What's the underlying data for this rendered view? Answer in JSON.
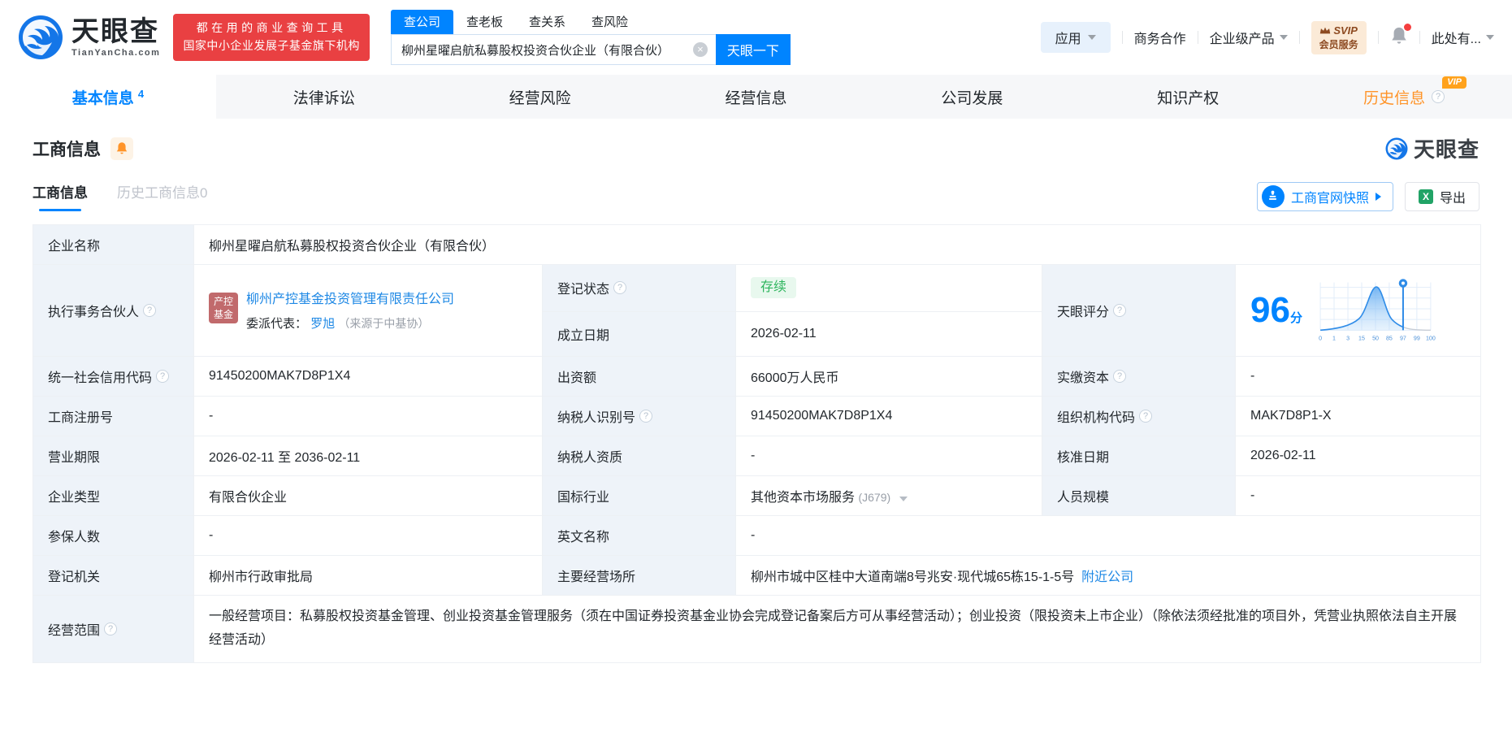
{
  "header": {
    "brand": "天眼查",
    "brand_domain": "TianYanCha.com",
    "slogan_line1": "都在用的商业查询工具",
    "slogan_line2": "国家中小企业发展子基金旗下机构",
    "search_tabs": [
      {
        "label": "查公司"
      },
      {
        "label": "查老板"
      },
      {
        "label": "查关系"
      },
      {
        "label": "查风险"
      }
    ],
    "search_value": "柳州星曜启航私募股权投资合伙企业（有限合伙）",
    "search_button": "天眼一下",
    "apps": "应用",
    "link_cooperation": "商务合作",
    "link_enterprise": "企业级产品",
    "svip_top": "SVIP",
    "svip_bottom": "会员服务",
    "user": "此处有..."
  },
  "nav": {
    "tabs": [
      {
        "label": "基本信息",
        "count": "4"
      },
      {
        "label": "法律诉讼"
      },
      {
        "label": "经营风险"
      },
      {
        "label": "经营信息"
      },
      {
        "label": "公司发展"
      },
      {
        "label": "知识产权"
      },
      {
        "label": "历史信息",
        "vip": "VIP"
      }
    ]
  },
  "section": {
    "title": "工商信息",
    "watermark_brand": "天眼查",
    "subtab_active": "工商信息",
    "subtab_history": "历史工商信息",
    "subtab_history_count": "0",
    "snapshot_button": "工商官网快照",
    "export_button": "导出"
  },
  "info": {
    "company_name_label": "企业名称",
    "company_name": "柳州星曜启航私募股权投资合伙企业（有限合伙）",
    "partner_label": "执行事务合伙人",
    "partner_tag_line1": "产控",
    "partner_tag_line2": "基金",
    "partner_name": "柳州产控基金投资管理有限责任公司",
    "delegate_label": "委派代表：",
    "delegate_name": "罗旭",
    "delegate_source": "（来源于中基协）",
    "reg_status_label": "登记状态",
    "reg_status": "存续",
    "establish_date_label": "成立日期",
    "establish_date": "2026-02-11",
    "score_label": "天眼评分",
    "score_value": "96",
    "score_unit": "分",
    "credit_code_label": "统一社会信用代码",
    "credit_code": "91450200MAK7D8P1X4",
    "capital_label": "出资额",
    "capital": "66000万人民币",
    "paid_capital_label": "实缴资本",
    "paid_capital": "-",
    "reg_no_label": "工商注册号",
    "reg_no": "-",
    "taxpayer_id_label": "纳税人识别号",
    "taxpayer_id": "91450200MAK7D8P1X4",
    "org_code_label": "组织机构代码",
    "org_code": "MAK7D8P1-X",
    "term_label": "营业期限",
    "term": "2026-02-11 至 2036-02-11",
    "taxpayer_qual_label": "纳税人资质",
    "taxpayer_qual": "-",
    "approval_date_label": "核准日期",
    "approval_date": "2026-02-11",
    "company_type_label": "企业类型",
    "company_type": "有限合伙企业",
    "industry_label": "国标行业",
    "industry": "其他资本市场服务",
    "industry_code": "(J679)",
    "staff_label": "人员规模",
    "staff": "-",
    "insured_label": "参保人数",
    "insured": "-",
    "en_name_label": "英文名称",
    "en_name": "-",
    "authority_label": "登记机关",
    "authority": "柳州市行政审批局",
    "address_label": "主要经营场所",
    "address": "柳州市城中区桂中大道南端8号兆安·现代城65栋15-1-5号",
    "address_link": "附近公司",
    "scope_label": "经营范围",
    "scope": "一般经营项目：私募股权投资基金管理、创业投资基金管理服务（须在中国证券投资基金业协会完成登记备案后方可从事经营活动）；创业投资（限投资未上市企业）（除依法须经批准的项目外，凭营业执照依法自主开展经营活动）"
  },
  "score_chart": {
    "type": "area",
    "x_labels": [
      "0",
      "1",
      "3",
      "15",
      "50",
      "85",
      "97",
      "99",
      "100"
    ],
    "marker_at": "97",
    "accent": "#1e88e5"
  },
  "colors": {
    "brand_blue": "#0084ff",
    "link_blue": "#1e88e5",
    "status_green": "#2db55d",
    "vip_orange": "#ff9429",
    "banner_red": "#e94042"
  }
}
